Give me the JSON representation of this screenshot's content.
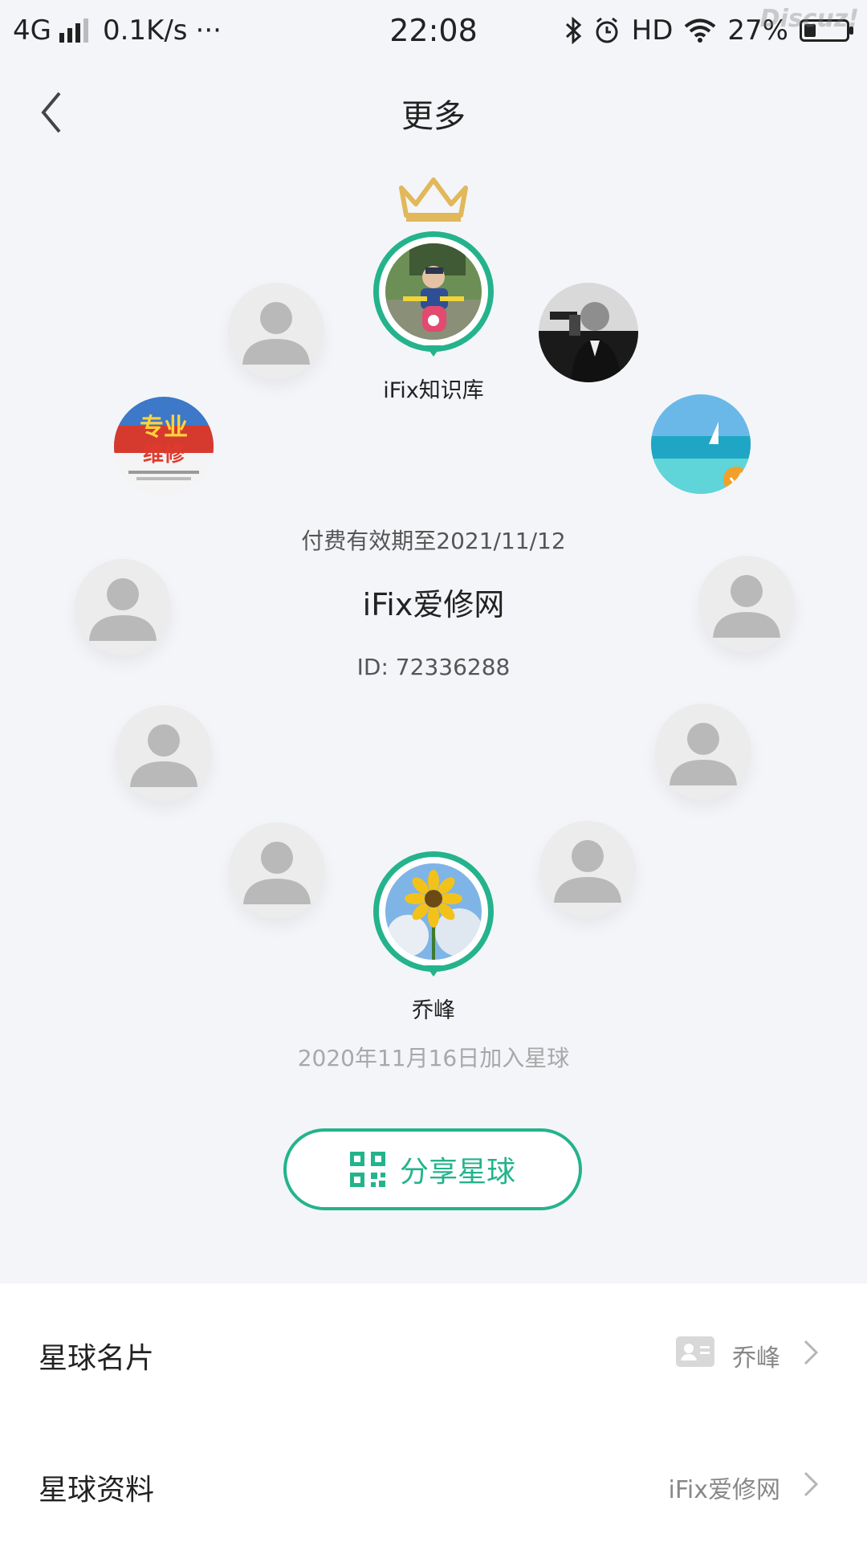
{
  "status_bar": {
    "network": "4G",
    "speed": "0.1K/s",
    "dots": "···",
    "time": "22:08",
    "hd": "HD",
    "battery": "27%",
    "battery_level": 0.27,
    "watermark": "Discuz!"
  },
  "header": {
    "title": "更多"
  },
  "orbit": {
    "owner_name": "iFix知识库",
    "member_name": "乔峰"
  },
  "center": {
    "paid_until": "付费有效期至2021/11/12",
    "group_name": "iFix爱修网",
    "group_id": "ID: 72336288"
  },
  "joined": "2020年11月16日加入星球",
  "share_button": {
    "label": "分享星球"
  },
  "rows": [
    {
      "label": "星球名片",
      "value": "乔峰",
      "icon": "id-card-icon"
    },
    {
      "label": "星球资料",
      "value": "iFix爱修网"
    }
  ],
  "colors": {
    "accent": "#24b38c",
    "background": "#f3f5f8"
  }
}
